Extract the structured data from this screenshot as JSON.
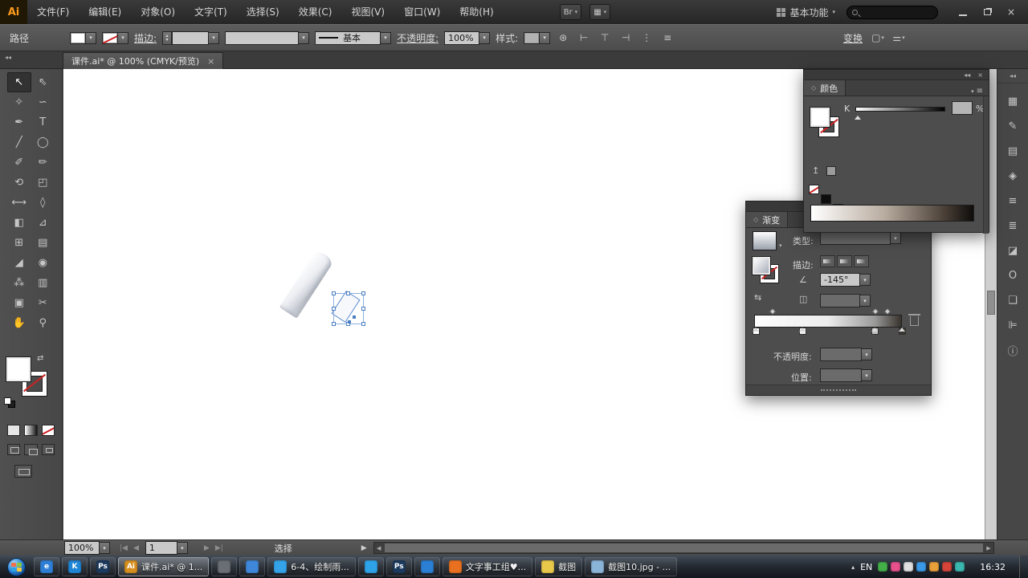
{
  "colors": {
    "accent": "#4a90d9",
    "selection": "#4a7fc1",
    "panel_bg": "#4d4d4d"
  },
  "titlebar": {
    "logo_text": "Ai",
    "menus": [
      {
        "label": "文件(F)"
      },
      {
        "label": "编辑(E)"
      },
      {
        "label": "对象(O)"
      },
      {
        "label": "文字(T)"
      },
      {
        "label": "选择(S)"
      },
      {
        "label": "效果(C)"
      },
      {
        "label": "视图(V)"
      },
      {
        "label": "窗口(W)"
      },
      {
        "label": "帮助(H)"
      }
    ],
    "extra_buttons": [
      {
        "name": "bridge-button",
        "glyph": "Br"
      },
      {
        "name": "arrange-documents-button",
        "glyph": "▦"
      }
    ],
    "workspace_label": "基本功能",
    "search_value": "",
    "close_glyph": "×"
  },
  "control_bar": {
    "object_label": "路径",
    "stroke_link": "描边:",
    "brush_name": "基本",
    "opacity_link": "不透明度:",
    "opacity_value": "100%",
    "style_label": "样式:",
    "transform_link": "变换",
    "icons": [
      {
        "name": "recolor-artwork-icon",
        "glyph": "⊛"
      },
      {
        "name": "align-left-icon",
        "glyph": "⊢"
      },
      {
        "name": "align-center-icon",
        "glyph": "⊤"
      },
      {
        "name": "align-right-icon",
        "glyph": "⊣"
      },
      {
        "name": "distribute-objects-icon",
        "glyph": "⋮"
      },
      {
        "name": "align-options-icon",
        "glyph": "≡"
      }
    ],
    "right_icons": [
      {
        "name": "isolate-object-icon",
        "glyph": "▢"
      },
      {
        "name": "select-similar-icon",
        "glyph": "⚌"
      }
    ]
  },
  "document_tab": {
    "title": "课件.ai* @ 100% (CMYK/预览)",
    "close_glyph": "×"
  },
  "toolbar": {
    "collapse_glyph": "◂◂",
    "tools": [
      {
        "name": "selection-tool",
        "glyph": "↖",
        "selected": true
      },
      {
        "name": "direct-selection-tool",
        "glyph": "⇖"
      },
      {
        "name": "magic-wand-tool",
        "glyph": "✧"
      },
      {
        "name": "lasso-tool",
        "glyph": "∽"
      },
      {
        "name": "pen-tool",
        "glyph": "✒"
      },
      {
        "name": "type-tool",
        "glyph": "T"
      },
      {
        "name": "line-segment-tool",
        "glyph": "╱"
      },
      {
        "name": "ellipse-tool",
        "glyph": "◯"
      },
      {
        "name": "paintbrush-tool",
        "glyph": "✐"
      },
      {
        "name": "pencil-tool",
        "glyph": "✏"
      },
      {
        "name": "rotate-tool",
        "glyph": "⟲"
      },
      {
        "name": "scale-tool",
        "glyph": "◰"
      },
      {
        "name": "width-tool",
        "glyph": "⟷"
      },
      {
        "name": "free-transform-tool",
        "glyph": "◊"
      },
      {
        "name": "shape-builder-tool",
        "glyph": "◧"
      },
      {
        "name": "perspective-grid-tool",
        "glyph": "⊿"
      },
      {
        "name": "mesh-tool",
        "glyph": "⊞"
      },
      {
        "name": "gradient-tool",
        "glyph": "▤"
      },
      {
        "name": "eyedropper-tool",
        "glyph": "◢"
      },
      {
        "name": "blend-tool",
        "glyph": "◉"
      },
      {
        "name": "symbol-sprayer-tool",
        "glyph": "⁂"
      },
      {
        "name": "column-graph-tool",
        "glyph": "▥"
      },
      {
        "name": "artboard-tool",
        "glyph": "▣"
      },
      {
        "name": "slice-tool",
        "glyph": "✂"
      },
      {
        "name": "hand-tool",
        "glyph": "✋"
      },
      {
        "name": "zoom-tool",
        "glyph": "⚲"
      }
    ]
  },
  "dock": {
    "collapse_glyph": "◂◂",
    "icons": [
      {
        "name": "color-guide-panel-icon",
        "glyph": "▦"
      },
      {
        "name": "brushes-panel-icon",
        "glyph": "✎"
      },
      {
        "name": "swatches-panel-icon",
        "glyph": "▤"
      },
      {
        "name": "symbols-panel-icon",
        "glyph": "◈"
      },
      {
        "name": "stroke-panel-icon",
        "glyph": "≡"
      },
      {
        "name": "layers-panel-icon",
        "glyph": "≣"
      },
      {
        "name": "transparency-panel-icon",
        "glyph": "◪"
      },
      {
        "name": "appearance-panel-icon",
        "glyph": "O"
      },
      {
        "name": "graphic-styles-panel-icon",
        "glyph": "❏"
      },
      {
        "name": "align-panel-icon",
        "glyph": "⊫"
      },
      {
        "name": "info-panel-icon",
        "glyph": "ⓘ"
      }
    ]
  },
  "color_panel": {
    "collapse_glyph": "◂◂",
    "close_glyph": "×",
    "title": "颜色",
    "menu_glyph": "≡",
    "channel_label": "K",
    "channel_value": "",
    "percent_label": "%",
    "up_glyph": "↥"
  },
  "gradient_panel": {
    "title": "渐变",
    "menu_glyph": "≡",
    "type_label": "类型:",
    "stroke_label": "描边:",
    "angle_glyph": "∠",
    "angle_value": "-145°",
    "reverse_glyph": "⇆",
    "aspect_glyph": "◫",
    "opacity_label": "不透明度:",
    "opacity_value": "",
    "location_label": "位置:",
    "location_value": ""
  },
  "status_bar": {
    "zoom_value": "100%",
    "nav_first_glyph": "|◀",
    "nav_prev_glyph": "◀",
    "artboard_value": "1",
    "nav_next_glyph": "▶",
    "nav_last_glyph": "▶|",
    "status_text": "选择",
    "expand_glyph": "▶",
    "hscroll_left_glyph": "◀",
    "hscroll_right_glyph": "▶"
  },
  "taskbar": {
    "items": [
      {
        "name": "taskbar-ie",
        "icon_text": "e",
        "icon_bg": "#2f7fd6",
        "label": ""
      },
      {
        "name": "taskbar-k-player",
        "icon_text": "K",
        "icon_bg": "#1f86d6",
        "label": ""
      },
      {
        "name": "taskbar-photoshop",
        "icon_text": "Ps",
        "icon_bg": "#1c3a5e",
        "label": ""
      },
      {
        "name": "taskbar-illustrator",
        "icon_text": "Ai",
        "icon_bg": "#d78f1e",
        "label": "课件.ai* @ 1...",
        "active": true
      },
      {
        "name": "taskbar-app-gray",
        "icon_text": "",
        "icon_bg": "#6a6f75",
        "label": ""
      },
      {
        "name": "taskbar-explorer",
        "icon_text": "",
        "icon_bg": "#3f88d9",
        "label": ""
      },
      {
        "name": "taskbar-browser-doc",
        "icon_text": "",
        "icon_bg": "#34a3e8",
        "label": "6-4、绘制雨..."
      },
      {
        "name": "taskbar-tencent",
        "icon_text": "",
        "icon_bg": "#2fa3e8",
        "label": ""
      },
      {
        "name": "taskbar-photoshop-2",
        "icon_text": "Ps",
        "icon_bg": "#1c3a5e",
        "label": ""
      },
      {
        "name": "taskbar-thunder",
        "icon_text": "",
        "icon_bg": "#2b7fd4",
        "label": ""
      },
      {
        "name": "taskbar-qq-group",
        "icon_text": "",
        "icon_bg": "#e8701f",
        "label": "文字事工组♥..."
      },
      {
        "name": "taskbar-folder",
        "icon_text": "",
        "icon_bg": "#e8c84a",
        "label": "截图"
      },
      {
        "name": "taskbar-image-viewer",
        "icon_text": "",
        "icon_bg": "#8ab4d8",
        "label": "截图10.jpg - ..."
      }
    ],
    "tray": {
      "chevron_glyph": "▴",
      "lang_label": "EN",
      "icons": [
        {
          "name": "tray-icon-green",
          "bg": "#44b049"
        },
        {
          "name": "tray-icon-pink",
          "bg": "#e8518d"
        },
        {
          "name": "tray-icon-white",
          "bg": "#e0e0e0"
        },
        {
          "name": "tray-icon-blue",
          "bg": "#3a9ae8"
        },
        {
          "name": "tray-icon-orange",
          "bg": "#e8a03a"
        },
        {
          "name": "tray-icon-red",
          "bg": "#d6453a"
        },
        {
          "name": "tray-icon-teal",
          "bg": "#3ab8b0"
        }
      ],
      "time": "16:32"
    }
  }
}
